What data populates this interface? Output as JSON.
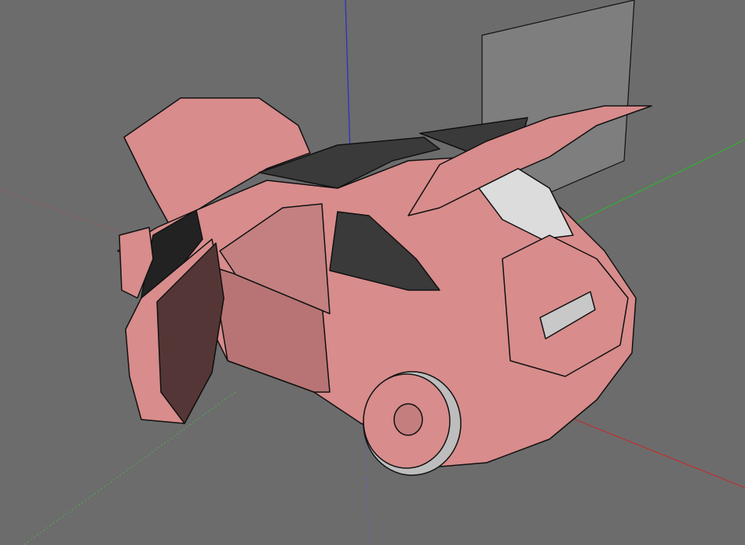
{
  "viewport": {
    "background_color": "#6c6c6c",
    "model": "car",
    "colors": {
      "body": "#d88c8c",
      "body_shadow": "#b87474",
      "body_dark": "#553636",
      "glass": "#3a3a3a",
      "panel": "#7e7e7e",
      "axis_red": "#c03030",
      "axis_green": "#30b030",
      "axis_blue": "#2a2ad0"
    }
  }
}
